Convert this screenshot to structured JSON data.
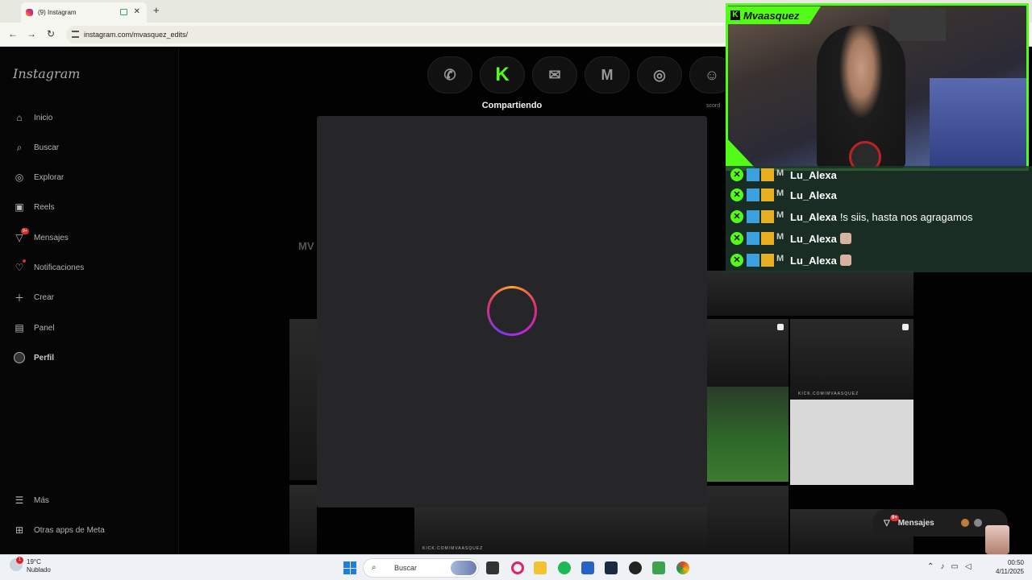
{
  "browser": {
    "tab_title": "(9) Instagram",
    "tab_close": "✕",
    "new_tab": "+",
    "url": "instagram.com/mvasquez_edits/"
  },
  "sidebar": {
    "logo": "Instagram",
    "items": [
      {
        "label": "Inicio",
        "icon": "home-icon"
      },
      {
        "label": "Buscar",
        "icon": "search-icon"
      },
      {
        "label": "Explorar",
        "icon": "compass-icon"
      },
      {
        "label": "Reels",
        "icon": "reels-icon"
      },
      {
        "label": "Mensajes",
        "icon": "messenger-icon",
        "badge": "9+"
      },
      {
        "label": "Notificaciones",
        "icon": "heart-icon"
      },
      {
        "label": "Crear",
        "icon": "plus-icon"
      },
      {
        "label": "Panel",
        "icon": "chart-icon"
      },
      {
        "label": "Perfil",
        "icon": "avatar"
      }
    ],
    "bottom": [
      {
        "label": "Más",
        "icon": "menu-icon"
      },
      {
        "label": "Otras apps de Meta",
        "icon": "meta-apps-icon"
      }
    ]
  },
  "share": {
    "title": "Compartiendo",
    "targets": [
      "whatsapp",
      "kick",
      "email",
      "mv",
      "instagram",
      "discord"
    ],
    "discord_label": "scord"
  },
  "profile_bg": {
    "name_fragment": "MV",
    "watermark": "KICK.COM/MVAASQUEZ"
  },
  "messages_pill": {
    "label": "Mensajes",
    "badge": "9+"
  },
  "stream": {
    "streamer": "Mvaasquez",
    "accent": "#53fc18",
    "chat": [
      {
        "user": "Lu_Alexa",
        "message": ""
      },
      {
        "user": "Lu_Alexa",
        "message": ""
      },
      {
        "user": "Lu_Alexa",
        "message": "!s siis, hasta nos agragamos"
      },
      {
        "user": "Lu_Alexa",
        "message": ""
      },
      {
        "user": "Lu_Alexa",
        "message": ""
      }
    ]
  },
  "taskbar": {
    "temp": "19°C",
    "weather": "Nublado",
    "weather_badge": "1",
    "search": "Buscar",
    "time": "00:50",
    "date": "4/11/2025"
  }
}
